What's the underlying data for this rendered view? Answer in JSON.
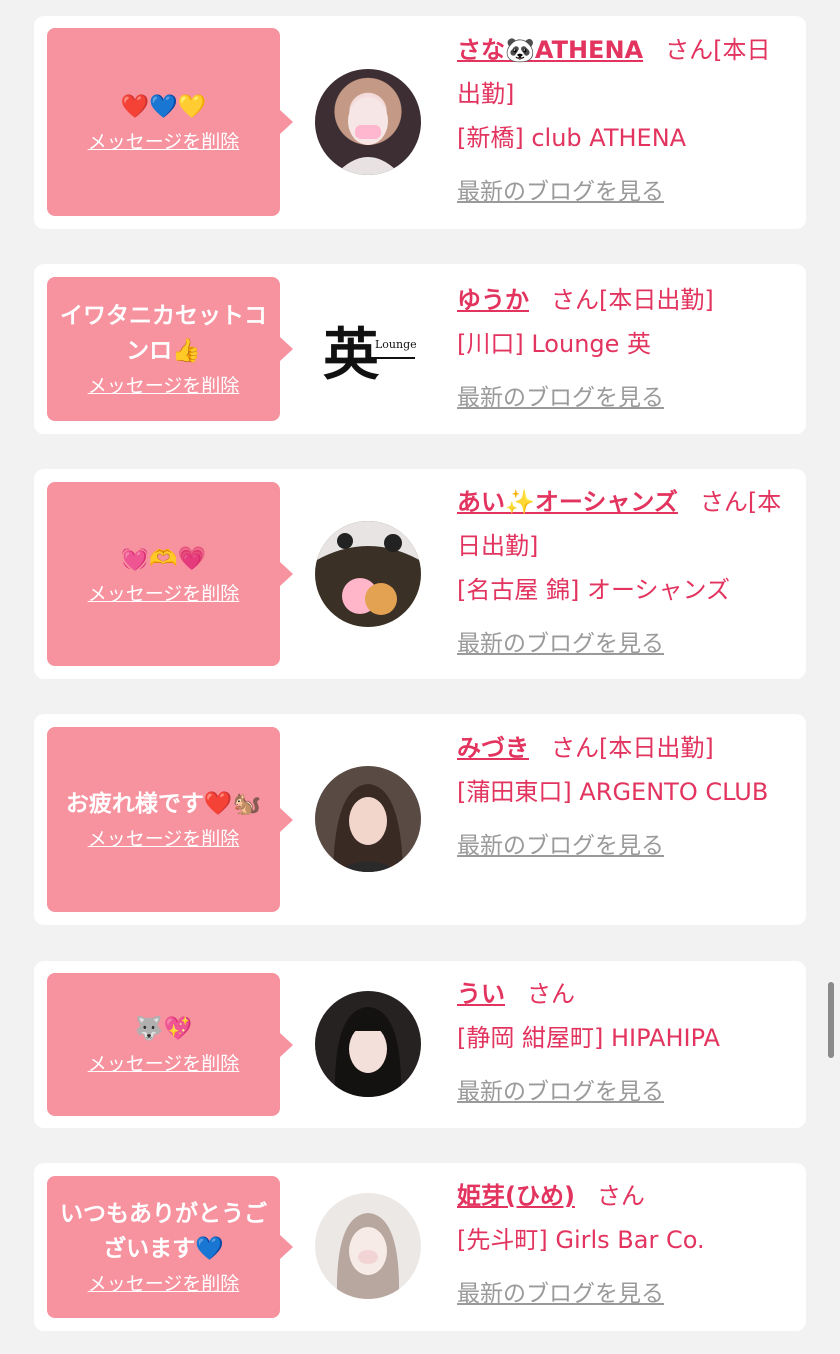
{
  "common": {
    "delete_label": "メッセージを削除",
    "blog_label": "最新のブログを見る"
  },
  "messages": [
    {
      "message": "❤️💙💛",
      "name": "さな🐼ATHENA",
      "san": "さん[本日出勤]",
      "shop": "[新橋] club ATHENA"
    },
    {
      "message": "イワタニカセットコンロ👍",
      "name": "ゆうか",
      "san": "さん[本日出勤]",
      "shop": "[川口] Lounge 英",
      "avatar_logo_text": "Lounge",
      "avatar_logo_kanji": "英"
    },
    {
      "message": "💓🫶💗",
      "name": "あい✨オーシャンズ",
      "san": "さん[本日出勤]",
      "shop": "[名古屋 錦] オーシャンズ"
    },
    {
      "message": "お疲れ様です❤️🐿️",
      "name": "みづき",
      "san": "さん[本日出勤]",
      "shop": "[蒲田東口] ARGENTO CLUB"
    },
    {
      "message": "🐺💖",
      "name": "うい",
      "san": "さん",
      "shop": "[静岡 紺屋町] HIPAHIPA"
    },
    {
      "message": "いつもありがとうございます💙",
      "name": "姫芽(ひめ)",
      "san": "さん",
      "shop": "[先斗町] Girls Bar Co."
    }
  ]
}
